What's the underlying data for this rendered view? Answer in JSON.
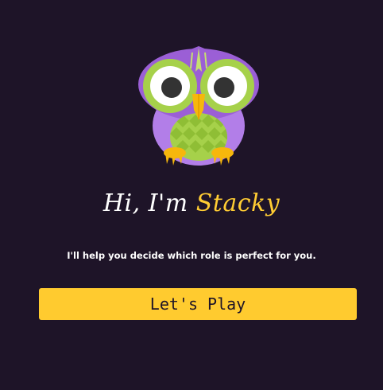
{
  "greeting": {
    "prefix": "Hi, I'm ",
    "name": "Stacky"
  },
  "subtitle": "I'll help you decide which role is perfect for you.",
  "play_button": {
    "label": "Let's Play"
  },
  "mascot": {
    "icon": "owl-mascot-icon"
  },
  "colors": {
    "background": "#1e1428",
    "accent": "#ffcb2f",
    "owl_body": "#9b5fd6",
    "owl_belly": "#a6d14a"
  }
}
